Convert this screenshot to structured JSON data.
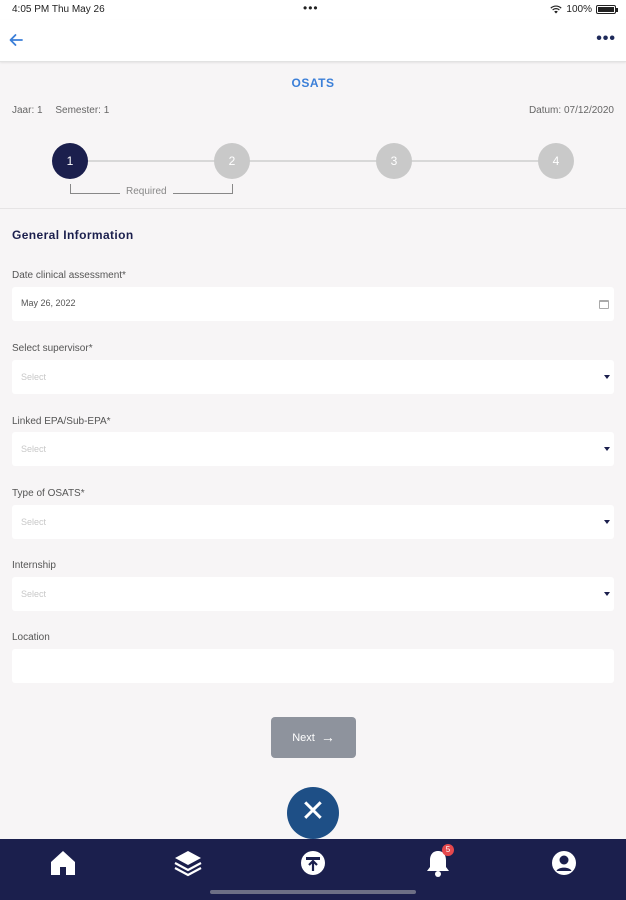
{
  "status_bar": {
    "time_date": "4:05 PM   Thu May 26",
    "center_dots": "•••",
    "battery": "100%",
    "battery_level": 1.0
  },
  "nav": {
    "back_icon": "arrow-left-icon",
    "more_icon": "more-horizontal-icon",
    "more_text": "•••"
  },
  "header": {
    "title": "OSATS",
    "year": "Jaar: 1",
    "semester": "Semester: 1",
    "date": "Datum: 07/12/2020"
  },
  "stepper": {
    "steps": [
      "1",
      "2",
      "3",
      "4"
    ],
    "active_step": 1,
    "required_label": "Required"
  },
  "form": {
    "section_title": "General Information",
    "fields": [
      {
        "label": "Date clinical assessment*",
        "value": "May 26, 2022",
        "type": "date"
      },
      {
        "label": "Select supervisor*",
        "placeholder": "Select",
        "type": "select"
      },
      {
        "label": "Linked EPA/Sub-EPA*",
        "placeholder": "Select",
        "type": "select"
      },
      {
        "label": "Type of OSATS*",
        "placeholder": "Select",
        "type": "select"
      },
      {
        "label": "Internship",
        "placeholder": "Select",
        "type": "select"
      },
      {
        "label": "Location",
        "value": "",
        "type": "text"
      }
    ],
    "next_label": "Next"
  },
  "fab": {
    "icon": "close-icon",
    "glyph": "✕"
  },
  "tab_bar": {
    "items": [
      {
        "name": "home",
        "icon": "home-icon"
      },
      {
        "name": "layers",
        "icon": "layers-icon"
      },
      {
        "name": "inbox",
        "icon": "inbox-icon"
      },
      {
        "name": "notifications",
        "icon": "bell-icon",
        "badge": "5"
      },
      {
        "name": "account",
        "icon": "account-icon"
      }
    ]
  },
  "colors": {
    "accent": "#3b7fd8",
    "navy": "#1b1f4d",
    "fab": "#1e4f86",
    "button_disabled": "#8e939d",
    "badge": "#e5484d",
    "background": "#f7f5f6"
  }
}
